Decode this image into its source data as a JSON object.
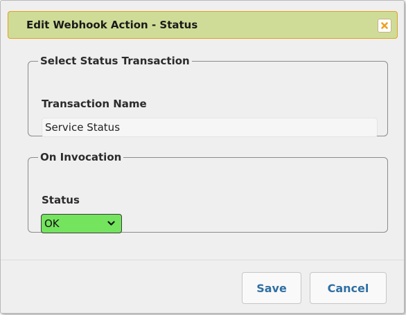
{
  "dialog": {
    "title": "Edit Webhook Action - Status",
    "close_icon": "close-icon"
  },
  "transaction_section": {
    "legend": "Select Status Transaction",
    "field_label": "Transaction Name",
    "value": "Service Status"
  },
  "invocation_section": {
    "legend": "On Invocation",
    "field_label": "Status",
    "selected": "OK",
    "selected_color": "#74e35e",
    "chevron_icon": "chevron-down-icon"
  },
  "buttons": {
    "save": "Save",
    "cancel": "Cancel"
  },
  "colors": {
    "titlebar": "#cfdc97",
    "titlebar_border": "#e0a020",
    "close_x": "#f0a020",
    "button_text": "#2f6fa3"
  }
}
